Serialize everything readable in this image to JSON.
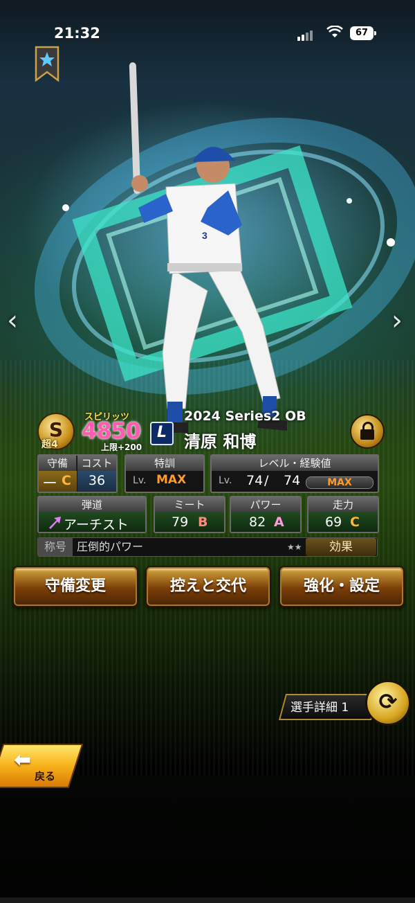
{
  "status_bar": {
    "time": "21:32",
    "battery": "67"
  },
  "card": {
    "grade_letter": "S",
    "cho_label": "超4",
    "spirits_label": "スピリッツ",
    "spirits_value": "4850",
    "spirits_sub": "上限+200",
    "team_mark": "L",
    "series": "2024 Series2 OB",
    "player_name": "清原 和博",
    "uniform_number": "3"
  },
  "stats": {
    "defense": {
      "label": "守備",
      "position": "一",
      "grade": "C"
    },
    "cost": {
      "label": "コスト",
      "value": "36"
    },
    "special_training": {
      "label": "特訓",
      "lv": "Lv.",
      "value": "MAX"
    },
    "level_exp": {
      "label": "レベル・経験値",
      "lv": "Lv.",
      "current": "74",
      "slash": "/",
      "max": "74",
      "bar_text": "MAX",
      "exp_fraction": 1.0
    },
    "trajectory": {
      "label": "弾道",
      "value": "アーチスト"
    },
    "meet": {
      "label": "ミート",
      "value": "79",
      "grade": "B"
    },
    "power": {
      "label": "パワー",
      "value": "82",
      "grade": "A"
    },
    "speed": {
      "label": "走力",
      "value": "69",
      "grade": "C"
    }
  },
  "title_row": {
    "label": "称号",
    "value": "圧倒的パワー",
    "stars": "★★",
    "effect_button": "効果"
  },
  "buttons": {
    "defense_change": "守備変更",
    "bench_swap": "控えと交代",
    "enhance": "強化・設定"
  },
  "player_detail": {
    "label": "選手詳細 1"
  },
  "back": {
    "label": "戻る"
  },
  "nav": {
    "prev": "‹",
    "next": "›"
  }
}
